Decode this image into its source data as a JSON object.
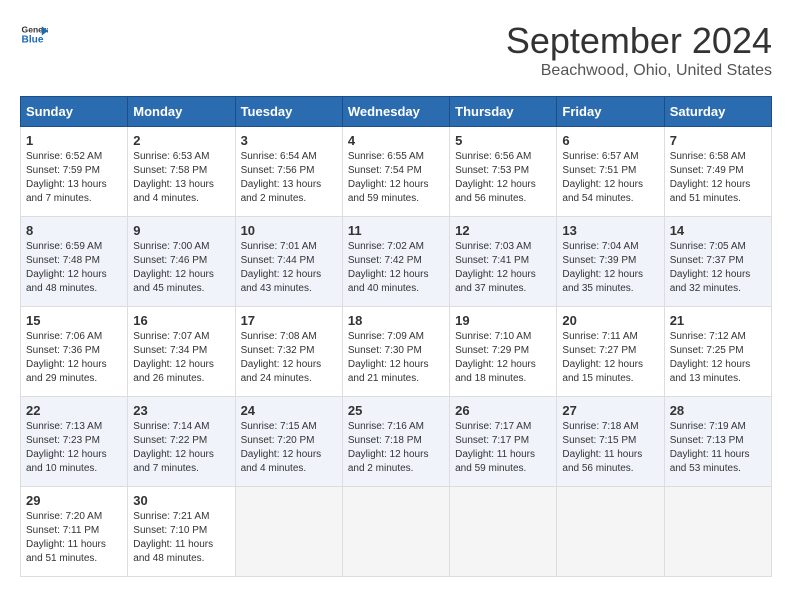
{
  "logo": {
    "text_general": "General",
    "text_blue": "Blue"
  },
  "title": "September 2024",
  "subtitle": "Beachwood, Ohio, United States",
  "days_of_week": [
    "Sunday",
    "Monday",
    "Tuesday",
    "Wednesday",
    "Thursday",
    "Friday",
    "Saturday"
  ],
  "weeks": [
    [
      {
        "day": 1,
        "lines": [
          "Sunrise: 6:52 AM",
          "Sunset: 7:59 PM",
          "Daylight: 13 hours",
          "and 7 minutes."
        ]
      },
      {
        "day": 2,
        "lines": [
          "Sunrise: 6:53 AM",
          "Sunset: 7:58 PM",
          "Daylight: 13 hours",
          "and 4 minutes."
        ]
      },
      {
        "day": 3,
        "lines": [
          "Sunrise: 6:54 AM",
          "Sunset: 7:56 PM",
          "Daylight: 13 hours",
          "and 2 minutes."
        ]
      },
      {
        "day": 4,
        "lines": [
          "Sunrise: 6:55 AM",
          "Sunset: 7:54 PM",
          "Daylight: 12 hours",
          "and 59 minutes."
        ]
      },
      {
        "day": 5,
        "lines": [
          "Sunrise: 6:56 AM",
          "Sunset: 7:53 PM",
          "Daylight: 12 hours",
          "and 56 minutes."
        ]
      },
      {
        "day": 6,
        "lines": [
          "Sunrise: 6:57 AM",
          "Sunset: 7:51 PM",
          "Daylight: 12 hours",
          "and 54 minutes."
        ]
      },
      {
        "day": 7,
        "lines": [
          "Sunrise: 6:58 AM",
          "Sunset: 7:49 PM",
          "Daylight: 12 hours",
          "and 51 minutes."
        ]
      }
    ],
    [
      {
        "day": 8,
        "lines": [
          "Sunrise: 6:59 AM",
          "Sunset: 7:48 PM",
          "Daylight: 12 hours",
          "and 48 minutes."
        ]
      },
      {
        "day": 9,
        "lines": [
          "Sunrise: 7:00 AM",
          "Sunset: 7:46 PM",
          "Daylight: 12 hours",
          "and 45 minutes."
        ]
      },
      {
        "day": 10,
        "lines": [
          "Sunrise: 7:01 AM",
          "Sunset: 7:44 PM",
          "Daylight: 12 hours",
          "and 43 minutes."
        ]
      },
      {
        "day": 11,
        "lines": [
          "Sunrise: 7:02 AM",
          "Sunset: 7:42 PM",
          "Daylight: 12 hours",
          "and 40 minutes."
        ]
      },
      {
        "day": 12,
        "lines": [
          "Sunrise: 7:03 AM",
          "Sunset: 7:41 PM",
          "Daylight: 12 hours",
          "and 37 minutes."
        ]
      },
      {
        "day": 13,
        "lines": [
          "Sunrise: 7:04 AM",
          "Sunset: 7:39 PM",
          "Daylight: 12 hours",
          "and 35 minutes."
        ]
      },
      {
        "day": 14,
        "lines": [
          "Sunrise: 7:05 AM",
          "Sunset: 7:37 PM",
          "Daylight: 12 hours",
          "and 32 minutes."
        ]
      }
    ],
    [
      {
        "day": 15,
        "lines": [
          "Sunrise: 7:06 AM",
          "Sunset: 7:36 PM",
          "Daylight: 12 hours",
          "and 29 minutes."
        ]
      },
      {
        "day": 16,
        "lines": [
          "Sunrise: 7:07 AM",
          "Sunset: 7:34 PM",
          "Daylight: 12 hours",
          "and 26 minutes."
        ]
      },
      {
        "day": 17,
        "lines": [
          "Sunrise: 7:08 AM",
          "Sunset: 7:32 PM",
          "Daylight: 12 hours",
          "and 24 minutes."
        ]
      },
      {
        "day": 18,
        "lines": [
          "Sunrise: 7:09 AM",
          "Sunset: 7:30 PM",
          "Daylight: 12 hours",
          "and 21 minutes."
        ]
      },
      {
        "day": 19,
        "lines": [
          "Sunrise: 7:10 AM",
          "Sunset: 7:29 PM",
          "Daylight: 12 hours",
          "and 18 minutes."
        ]
      },
      {
        "day": 20,
        "lines": [
          "Sunrise: 7:11 AM",
          "Sunset: 7:27 PM",
          "Daylight: 12 hours",
          "and 15 minutes."
        ]
      },
      {
        "day": 21,
        "lines": [
          "Sunrise: 7:12 AM",
          "Sunset: 7:25 PM",
          "Daylight: 12 hours",
          "and 13 minutes."
        ]
      }
    ],
    [
      {
        "day": 22,
        "lines": [
          "Sunrise: 7:13 AM",
          "Sunset: 7:23 PM",
          "Daylight: 12 hours",
          "and 10 minutes."
        ]
      },
      {
        "day": 23,
        "lines": [
          "Sunrise: 7:14 AM",
          "Sunset: 7:22 PM",
          "Daylight: 12 hours",
          "and 7 minutes."
        ]
      },
      {
        "day": 24,
        "lines": [
          "Sunrise: 7:15 AM",
          "Sunset: 7:20 PM",
          "Daylight: 12 hours",
          "and 4 minutes."
        ]
      },
      {
        "day": 25,
        "lines": [
          "Sunrise: 7:16 AM",
          "Sunset: 7:18 PM",
          "Daylight: 12 hours",
          "and 2 minutes."
        ]
      },
      {
        "day": 26,
        "lines": [
          "Sunrise: 7:17 AM",
          "Sunset: 7:17 PM",
          "Daylight: 11 hours",
          "and 59 minutes."
        ]
      },
      {
        "day": 27,
        "lines": [
          "Sunrise: 7:18 AM",
          "Sunset: 7:15 PM",
          "Daylight: 11 hours",
          "and 56 minutes."
        ]
      },
      {
        "day": 28,
        "lines": [
          "Sunrise: 7:19 AM",
          "Sunset: 7:13 PM",
          "Daylight: 11 hours",
          "and 53 minutes."
        ]
      }
    ],
    [
      {
        "day": 29,
        "lines": [
          "Sunrise: 7:20 AM",
          "Sunset: 7:11 PM",
          "Daylight: 11 hours",
          "and 51 minutes."
        ]
      },
      {
        "day": 30,
        "lines": [
          "Sunrise: 7:21 AM",
          "Sunset: 7:10 PM",
          "Daylight: 11 hours",
          "and 48 minutes."
        ]
      },
      null,
      null,
      null,
      null,
      null
    ]
  ]
}
